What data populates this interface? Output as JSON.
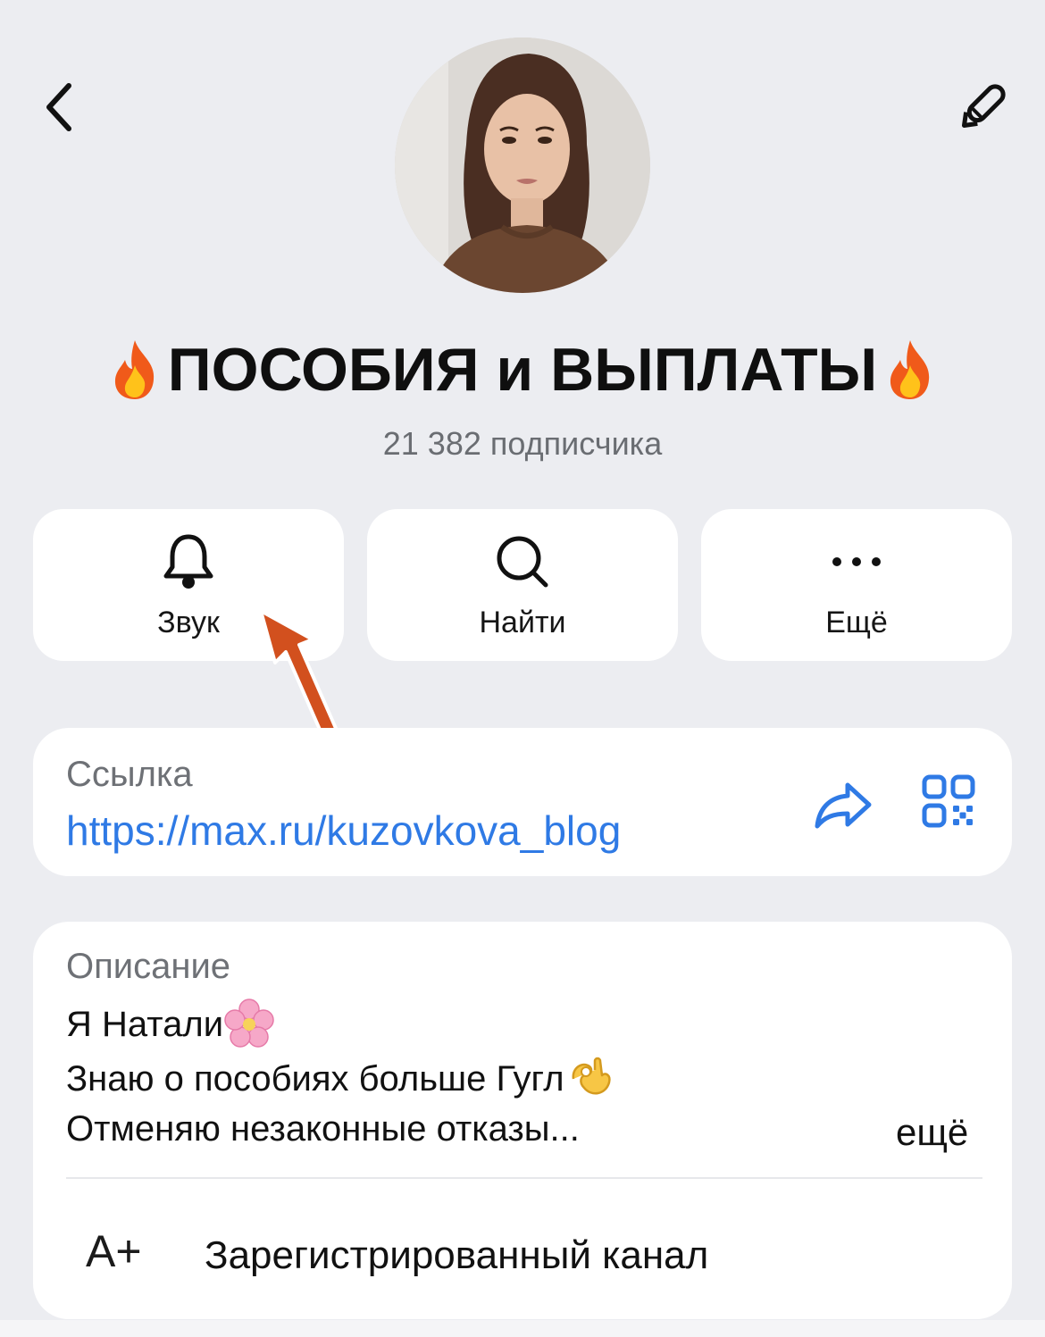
{
  "header": {
    "back_icon": "chevron-left-icon",
    "edit_icon": "pencil-icon"
  },
  "channel": {
    "avatar": "channel-avatar-photo",
    "title": "ПОСОБИЯ и ВЫПЛАТЫ",
    "title_emoji": "fire-emoji",
    "subscribers": "21 382 подписчика"
  },
  "actions": [
    {
      "label": "Звук",
      "icon": "bell-icon"
    },
    {
      "label": "Найти",
      "icon": "search-icon"
    },
    {
      "label": "Ещё",
      "icon": "more-dots-icon"
    }
  ],
  "annotation": {
    "icon": "red-arrow-pointer"
  },
  "link": {
    "caption": "Ссылка",
    "url": "https://max.ru/kuzovkova_blog",
    "share_icon": "share-arrow-icon",
    "qr_icon": "qr-code-icon"
  },
  "description": {
    "caption": "Описание",
    "line1": "Я Натали",
    "line1_emoji": "cherry-blossom-emoji",
    "line2": "Знаю о пособиях больше Гугл",
    "line2_emoji": "ok-hand-emoji",
    "line3": "Отменяю незаконные отказы...",
    "more": "ещё"
  },
  "registration": {
    "icon_text": "A+",
    "label": "Зарегистрированный канал"
  },
  "colors": {
    "background": "#ECEDF1",
    "card": "#FFFFFF",
    "link": "#2F7AE5",
    "secondary_text": "#6E7176",
    "arrow": "#D2501E"
  }
}
